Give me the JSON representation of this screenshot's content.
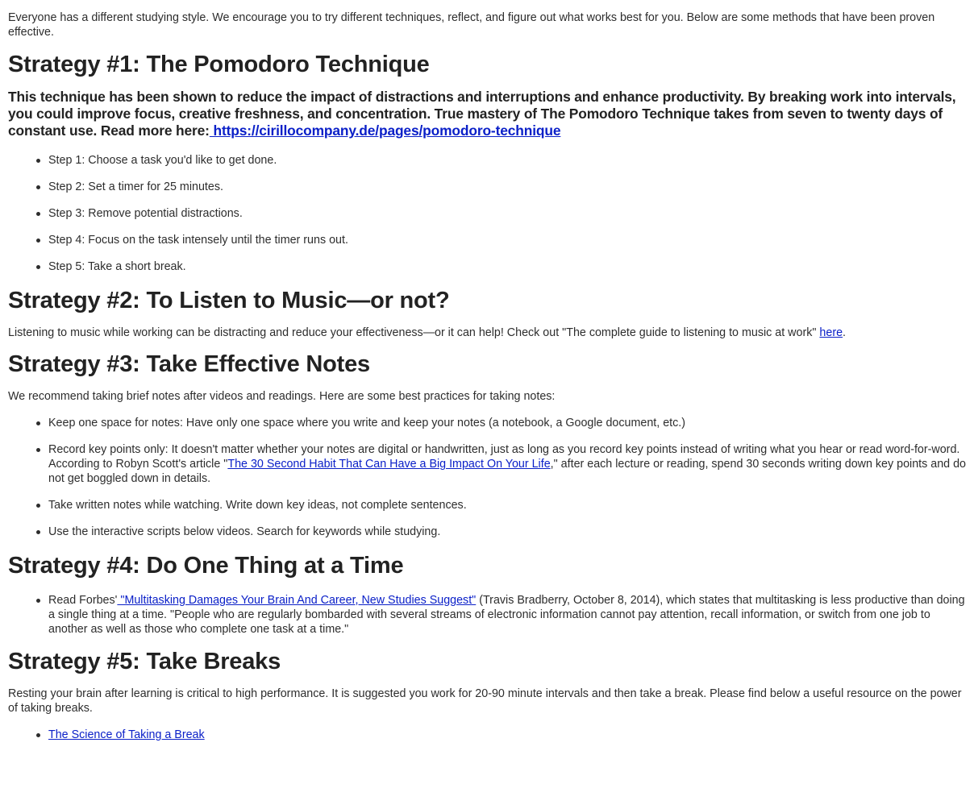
{
  "intro": "Everyone has a different studying style. We encourage you to try different techniques, reflect, and figure out what works best for you. Below are some methods that have been proven effective.",
  "s1": {
    "heading": "Strategy #1: The Pomodoro Technique",
    "lead": "This technique has been shown to reduce the impact of distractions and interruptions and enhance productivity. By breaking work into intervals, you could improve focus, creative freshness, and concentration. True mastery of The Pomodoro Technique takes from seven to twenty days of constant use. Read more here:",
    "link": " https://cirillocompany.de/pages/pomodoro-technique",
    "steps": [
      "Step 1: Choose a task you'd like to get done.",
      "Step 2: Set a timer for 25 minutes.",
      "Step 3: Remove potential distractions.",
      "Step 4: Focus on the task intensely until the timer runs out.",
      "Step 5: Take a short break."
    ]
  },
  "s2": {
    "heading": "Strategy #2: To Listen to Music—or not?",
    "text": "Listening to music while working can be distracting and reduce your effectiveness—or it can help! Check out \"The complete guide to listening to music at work\" ",
    "link": "here",
    "after": "."
  },
  "s3": {
    "heading": "Strategy #3: Take Effective Notes",
    "text": "We recommend taking brief notes after videos and readings. Here are some best practices for taking notes:",
    "item1": "Keep one space for notes: Have only one space where you write and keep your notes (a notebook, a Google document, etc.)",
    "item2_pre": "Record key points only: It doesn't matter whether your notes are digital or handwritten, just as long as you record key points instead of writing what you hear or read word-for-word. According to Robyn Scott's article \"",
    "item2_link": "The 30 Second Habit That Can Have a Big Impact On Your Life",
    "item2_post": ",\" after each lecture or reading, spend 30 seconds writing down key points and do not get boggled down in details.",
    "item3": "Take written notes while watching. Write down key ideas, not complete sentences.",
    "item4": "Use the interactive scripts below videos. Search for keywords while studying."
  },
  "s4": {
    "heading": "Strategy #4: Do One Thing at a Time",
    "pre": "Read Forbes'",
    "link": " \"Multitasking Damages Your Brain And Career, New Studies Suggest\"",
    "post": " (Travis Bradberry, October 8, 2014), which states that multitasking is less productive than doing a single thing at a time. \"People who are regularly bombarded with several streams of electronic information cannot pay attention, recall information, or switch from one job to another as well as those who complete one task at a time.\""
  },
  "s5": {
    "heading": "Strategy #5: Take Breaks",
    "text": "Resting your brain after learning is critical to high performance. It is suggested you work for 20-90 minute intervals and then take a break. Please find below a useful resource on the power of taking breaks.",
    "link": "The Science of Taking a Break"
  }
}
